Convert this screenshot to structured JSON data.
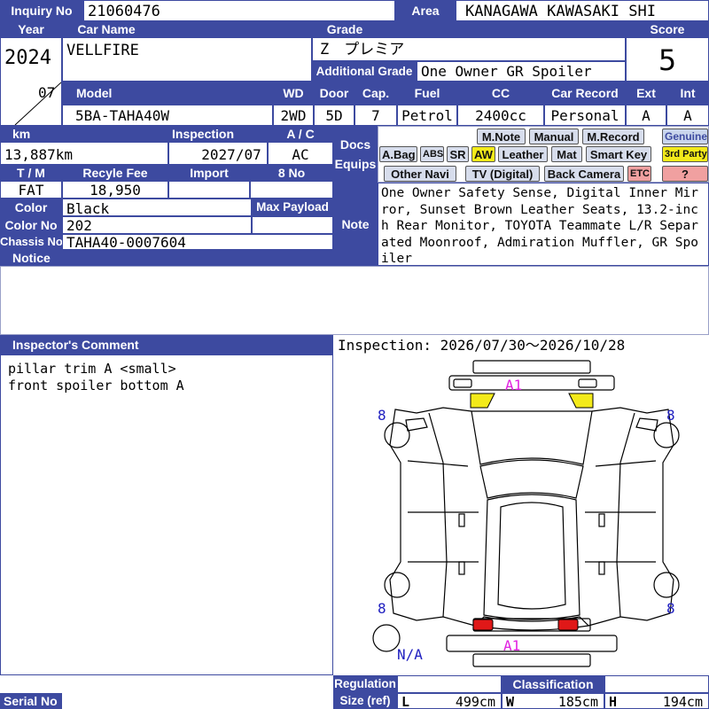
{
  "header": {
    "inquiry_label": "Inquiry No",
    "inquiry_no": "21060476",
    "area_label": "Area",
    "area": "KANAGAWA KAWASAKI SHI"
  },
  "row1": {
    "year_label": "Year",
    "car_name_label": "Car Name",
    "grade_label": "Grade",
    "score_label": "Score",
    "year": "2024",
    "month": "07",
    "car_name": "VELLFIRE",
    "grade": "Z　プレミア",
    "additional_grade_label": "Additional Grade",
    "additional_grade": "One Owner GR Spoiler",
    "score": "5"
  },
  "row2": {
    "model_label": "Model",
    "wd_label": "WD",
    "door_label": "Door",
    "cap_label": "Cap.",
    "fuel_label": "Fuel",
    "cc_label": "CC",
    "record_label": "Car Record",
    "ext_label": "Ext",
    "int_label": "Int",
    "model": "5BA-TAHA40W",
    "wd": "2WD",
    "door": "5D",
    "cap": "7",
    "fuel": "Petrol",
    "cc": "2400cc",
    "record": "Personal",
    "ext": "A",
    "int": "A"
  },
  "specs": {
    "km_label": "km",
    "inspection_label": "Inspection",
    "ac_label": "A / C",
    "km": "13,887km",
    "inspection": "2027/07",
    "ac": "AC",
    "tm_label": "T / M",
    "recycle_label": "Recyle Fee",
    "import_label": "Import",
    "eight_no_label": "8 No",
    "tm": "FAT",
    "recycle": "18,950",
    "color_label": "Color",
    "color": "Black",
    "max_payload_label": "Max Payload",
    "color_no_label": "Color No",
    "color_no": "202",
    "chassis_label": "Chassis No",
    "chassis": "TAHA40-0007604",
    "notice_label": "Notice"
  },
  "docs": {
    "label_line1": "Docs",
    "label_line2": "Equips",
    "row1": [
      "M.Note",
      "Manual",
      "M.Record"
    ],
    "genuine": "Genuine",
    "row2": [
      "A.Bag",
      "ABS",
      "SR",
      "AW",
      "Leather",
      "Mat",
      "Smart Key"
    ],
    "third_party": "3rd Party",
    "row3": [
      "Other Navi",
      "TV (Digital)",
      "Back Camera",
      "ETC"
    ],
    "question": "?"
  },
  "note": {
    "label": "Note",
    "text": "One Owner Safety Sense, Digital Inner Mirror, Sunset Brown Leather Seats, 13.2-inch Rear Monitor, TOYOTA Teammate L/R Separated Moonroof, Admiration Muffler, GR Spoiler"
  },
  "inspector": {
    "label": "Inspector's Comment",
    "line1": "pillar trim A <small>",
    "line2": "front spoiler bottom A",
    "inspection_range": "Inspection: 2026/07/30～2026/10/28"
  },
  "diagram": {
    "front_mark": "A1",
    "rear_mark": "A1",
    "tire_fl": "8",
    "tire_fr": "8",
    "tire_rl": "8",
    "tire_rr": "8",
    "spare": "N/A",
    "mark_color": "#e020e0",
    "tire_color": "#2020c0",
    "front_light_color": "#f3ea1a",
    "rear_light_color": "#e01818"
  },
  "footer": {
    "serial_label": "Serial No",
    "regulation_label": "Regulation",
    "size_label": "Size (ref)",
    "classification_label": "Classification",
    "l_label": "L",
    "l_value": "499cm",
    "w_label": "W",
    "w_value": "185cm",
    "h_label": "H",
    "h_value": "194cm"
  }
}
